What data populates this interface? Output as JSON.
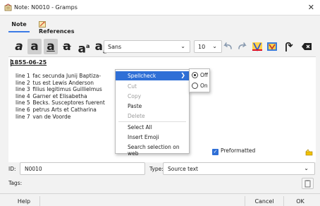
{
  "window": {
    "title": "Note: N0010 - Gramps",
    "close_glyph": "✕"
  },
  "tabs": [
    {
      "label": "Note",
      "active": true
    },
    {
      "label": "References",
      "active": false
    }
  ],
  "toolbar": {
    "font_family": "Sans",
    "font_size": "10",
    "dropdown_glyph": "⌄"
  },
  "note": {
    "date_heading": "1855-06-25",
    "lines": [
      {
        "label": "line 1",
        "text": "fac secunda Junij Baptiza-"
      },
      {
        "label": "line 2",
        "text": "tus est Lewis Anderson"
      },
      {
        "label": "line 3",
        "text": "filius legitimus Guillielmus"
      },
      {
        "label": "line 4",
        "text": "Garner et Elisabetha"
      },
      {
        "label": "line 5",
        "text": "Becks. Susceptores fuerent"
      },
      {
        "label": "line 6",
        "text": "petrus Arts et Catharina"
      },
      {
        "label": "line 7",
        "text": "van de Voorde"
      }
    ]
  },
  "context_menu": {
    "items": [
      {
        "label": "Spellcheck",
        "state": "highlighted",
        "has_submenu": true
      },
      {
        "label": "Cut",
        "state": "disabled"
      },
      {
        "label": "Copy",
        "state": "disabled"
      },
      {
        "label": "Paste",
        "state": "enabled"
      },
      {
        "label": "Delete",
        "state": "disabled"
      },
      {
        "label": "Select All",
        "state": "enabled"
      },
      {
        "label": "Insert Emoji",
        "state": "enabled"
      },
      {
        "label": "Search selection on web",
        "state": "enabled"
      }
    ],
    "submenu_arrow": "❯",
    "spellcheck_submenu": [
      {
        "label": "Off",
        "selected": true
      },
      {
        "label": "On",
        "selected": false
      }
    ]
  },
  "preformatted": {
    "label": "Preformatted",
    "checked": true
  },
  "id_row": {
    "id_label": "ID:",
    "id_value": "N0010",
    "type_label": "Type:",
    "type_value": "Source text"
  },
  "tags_row": {
    "tags_label": "Tags:"
  },
  "buttons": {
    "help": "Help",
    "cancel": "Cancel",
    "ok": "OK"
  },
  "colors": {
    "accent": "#2f6fd6",
    "tab_underline": "#3c7be6",
    "window_bg": "#f2f2f2"
  }
}
